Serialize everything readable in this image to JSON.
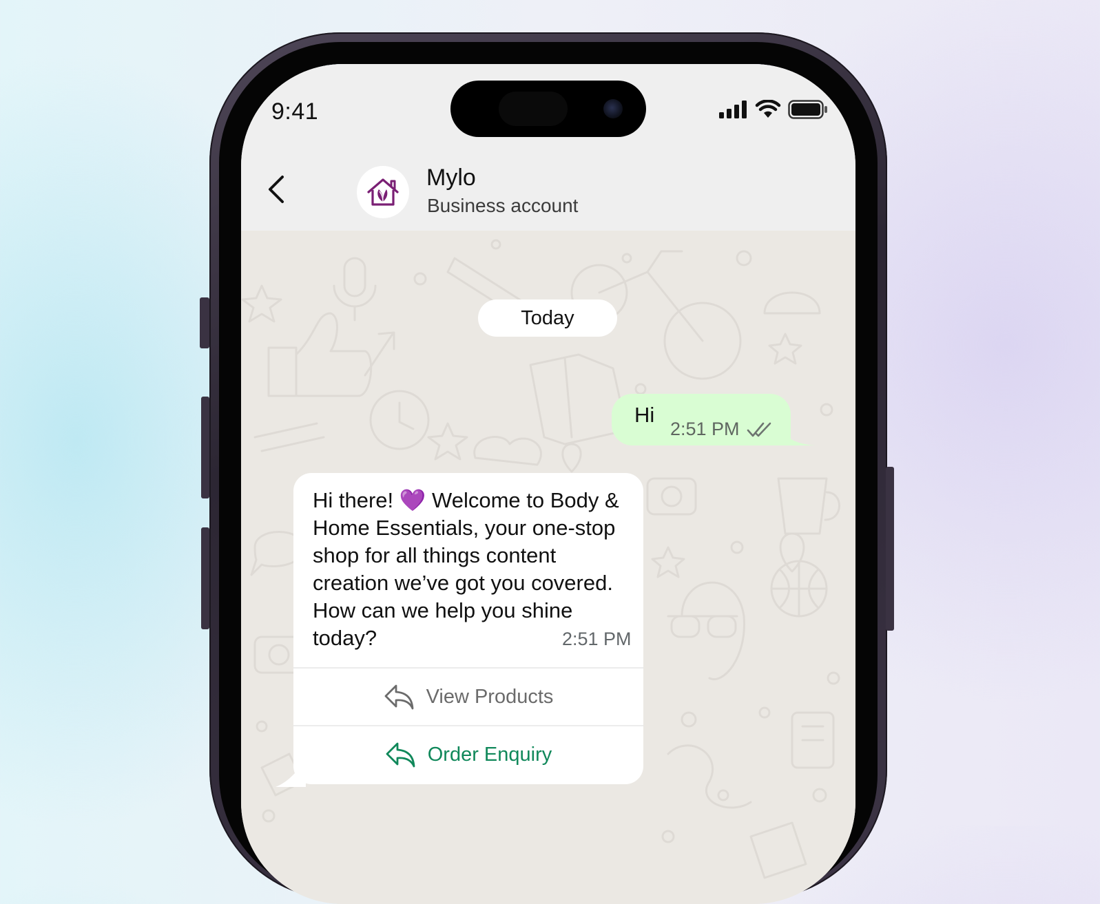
{
  "status_bar": {
    "time": "9:41",
    "icons": [
      "cellular-signal-icon",
      "wifi-icon",
      "battery-icon"
    ]
  },
  "header": {
    "back_icon": "chevron-left-icon",
    "avatar_icon": "house-leaf-logo-icon",
    "contact_name": "Mylo",
    "contact_subtitle": "Business account"
  },
  "chat": {
    "date_separator": "Today",
    "messages": [
      {
        "direction": "outgoing",
        "text": "Hi",
        "time": "2:51 PM",
        "status_icon": "double-check-icon"
      },
      {
        "direction": "incoming",
        "text_before_emoji": "Hi there!",
        "emoji": "💜",
        "text_after_emoji": "Welcome to Body & Home Essentials, your one-stop shop for all things content creation we’ve got you covered. How can we help you shine today?",
        "time": "2:51 PM",
        "quick_replies": [
          {
            "label": "View Products",
            "icon": "reply-arrow-icon",
            "color": "#6b6b6b"
          },
          {
            "label": "Order Enquiry",
            "icon": "reply-arrow-icon",
            "color": "#10885a"
          }
        ]
      }
    ]
  },
  "colors": {
    "outgoing_bubble": "#d9fdd3",
    "incoming_bubble": "#ffffff",
    "chat_background": "#ebe8e3",
    "header_background": "#efefef",
    "accent_green": "#10885a",
    "brand_purple": "#7a1f74"
  }
}
